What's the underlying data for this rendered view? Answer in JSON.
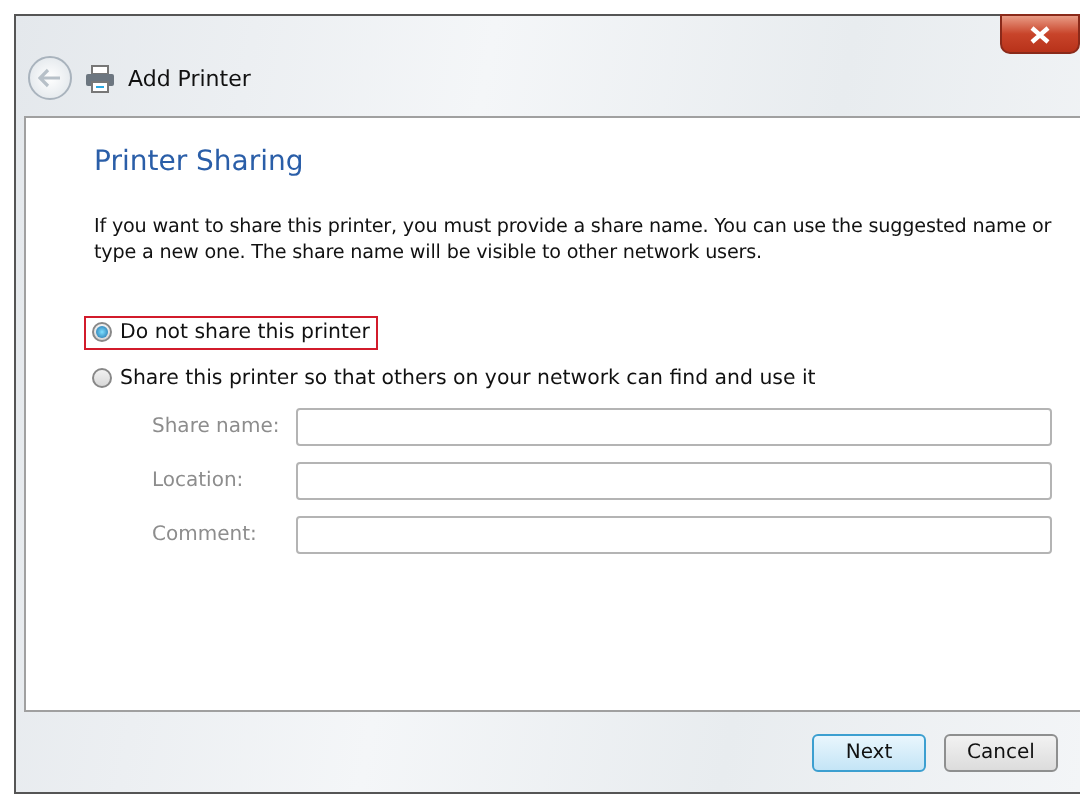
{
  "window": {
    "title": "Add Printer"
  },
  "heading": "Printer Sharing",
  "description": "If you want to share this printer, you must provide a share name. You can use the suggested name or type a new one. The share name will be visible to other network users.",
  "options": [
    {
      "label": "Do not share this printer",
      "selected": true,
      "highlighted": true
    },
    {
      "label": "Share this printer so that others on your network can find and use it",
      "selected": false,
      "highlighted": false
    }
  ],
  "fields": [
    {
      "label": "Share name:",
      "disabled": true
    },
    {
      "label": "Location:",
      "disabled": true
    },
    {
      "label": "Comment:",
      "disabled": true
    }
  ],
  "buttons": [
    {
      "label": "Next",
      "default": true
    },
    {
      "label": "Cancel",
      "default": false
    }
  ]
}
